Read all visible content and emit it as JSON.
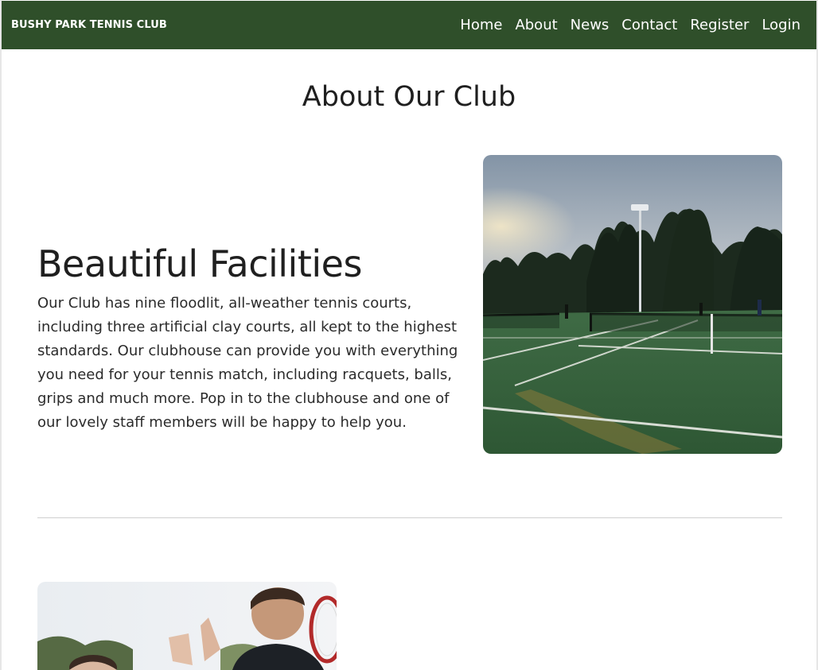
{
  "navbar": {
    "brand": "BUSHY PARK TENNIS CLUB",
    "links": [
      "Home",
      "About",
      "News",
      "Contact",
      "Register",
      "Login"
    ],
    "background_color": "#2f4f2a"
  },
  "page": {
    "title": "About Our Club"
  },
  "facilities": {
    "heading": "Beautiful Facilities",
    "text": "Our Club has nine floodlit, all-weather tennis courts, including three artificial clay courts, all kept to the highest standards. Our clubhouse can provide you with everything you need for your tennis match, including racquets, balls, grips and much more. Pop in to the clubhouse and one of our lovely staff members will be happy to help you.",
    "image_icon": "tennis-courts-photo"
  },
  "next_section": {
    "image_icon": "players-high-five-photo"
  }
}
